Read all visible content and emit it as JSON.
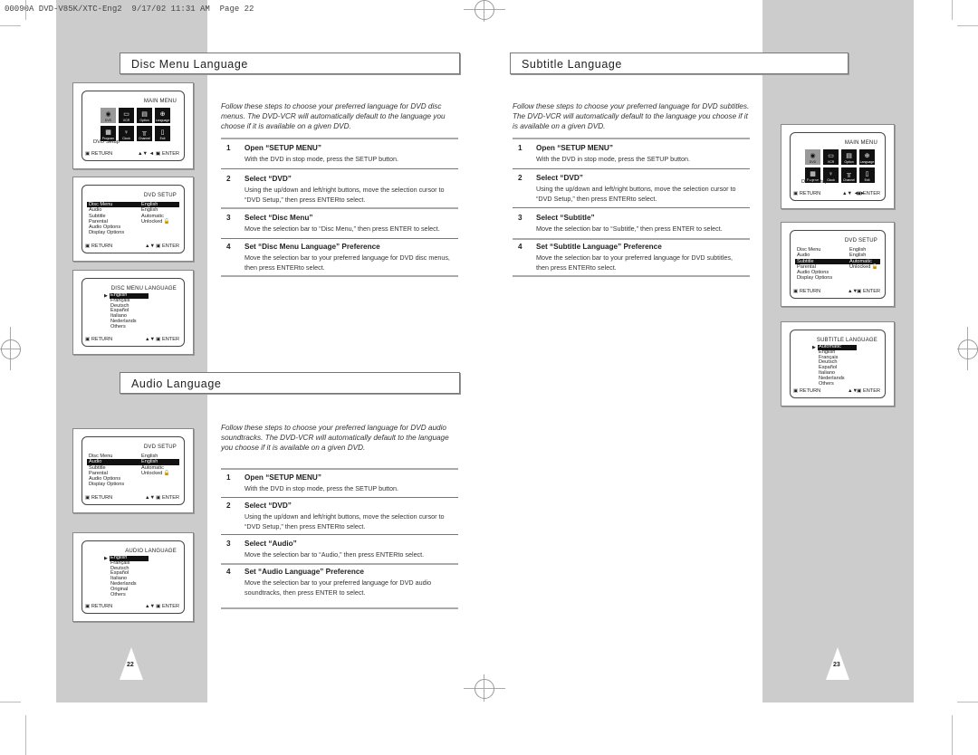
{
  "header": {
    "slug": "00090A DVD-V85K/XTC-Eng2  9/17/02 11:31 AM  Page 22"
  },
  "left_page": {
    "page_number": "22",
    "disc_menu": {
      "title": "Disc Menu Language",
      "intro": "Follow these steps to choose your preferred language for DVD disc menus. The DVD-VCR will automatically default to the language you choose if it is available on a given DVD.",
      "steps": [
        {
          "num": "1",
          "title": "Open “SETUP MENU”",
          "body": "With the DVD in stop mode, press the SETUP button."
        },
        {
          "num": "2",
          "title": "Select “DVD”",
          "body": "Using the up/down and left/right buttons, move the selection cursor to “DVD Setup,” then press ENTERto select."
        },
        {
          "num": "3",
          "title": "Select “Disc Menu”",
          "body": "Move the selection bar to “Disc Menu,” then press ENTER to select."
        },
        {
          "num": "4",
          "title": "Set “Disc Menu Language” Preference",
          "body": "Move the selection bar to your preferred language for DVD disc menus, then press ENTERto select."
        }
      ],
      "screens": {
        "main_menu": {
          "title": "MAIN MENU",
          "caption": "DVD Setup"
        },
        "dvd_setup": {
          "title": "DVD SETUP",
          "selected": "Disc Menu"
        },
        "language": {
          "title": "DISC MENU LANGUAGE",
          "items": [
            "English",
            "Français",
            "Deutsch",
            "Español",
            "Italiano",
            "Nederlands",
            "Others"
          ],
          "selected": "English"
        }
      }
    },
    "audio": {
      "title": "Audio Language",
      "intro": "Follow these steps to choose your preferred language for DVD audio soundtracks. The DVD-VCR will automatically default to the language you choose if it is available on a given DVD.",
      "steps": [
        {
          "num": "1",
          "title": "Open “SETUP MENU”",
          "body": "With the DVD in stop mode, press the SETUP button."
        },
        {
          "num": "2",
          "title": "Select “DVD”",
          "body": "Using the up/down and left/right buttons, move the selection cursor to “DVD Setup,” then press ENTERto select."
        },
        {
          "num": "3",
          "title": "Select “Audio”",
          "body": "Move the selection bar to “Audio,” then press ENTERto select."
        },
        {
          "num": "4",
          "title": "Set “Audio Language” Preference",
          "body": "Move the selection bar to your preferred language for DVD audio soundtracks, then press ENTER to select."
        }
      ],
      "screens": {
        "dvd_setup": {
          "title": "DVD SETUP",
          "selected": "Audio"
        },
        "language": {
          "title": "AUDIO LANGUAGE",
          "items": [
            "English",
            "Français",
            "Deutsch",
            "Español",
            "Italiano",
            "Nederlands",
            "Original",
            "Others"
          ],
          "selected": "English"
        }
      }
    }
  },
  "right_page": {
    "page_number": "23",
    "subtitle": {
      "title": "Subtitle Language",
      "intro": "Follow these steps to choose your preferred language for DVD subtitles. The DVD-VCR will automatically default to the language you choose if it is available on a given DVD.",
      "steps": [
        {
          "num": "1",
          "title": "Open “SETUP MENU”",
          "body": "With the DVD in stop mode, press the SETUP button."
        },
        {
          "num": "2",
          "title": "Select “DVD”",
          "body": "Using the up/down and left/right buttons, move the selection cursor to “DVD Setup,” then press ENTERto select."
        },
        {
          "num": "3",
          "title": "Select “Subtitle”",
          "body": "Move the selection bar to “Subtitle,” then press ENTER to select."
        },
        {
          "num": "4",
          "title": "Set “Subtitle Language” Preference",
          "body": "Move the selection bar to your preferred language for DVD subtitles, then press ENTERto select."
        }
      ],
      "screens": {
        "main_menu": {
          "title": "MAIN MENU",
          "caption": "DVD Setup"
        },
        "dvd_setup": {
          "title": "DVD SETUP",
          "selected": "Subtitle"
        },
        "language": {
          "title": "SUBTITLE LANGUAGE",
          "items": [
            "Automatic",
            "English",
            "Français",
            "Deutsch",
            "Español",
            "Italiano",
            "Nederlands",
            "Others"
          ],
          "selected": "Automatic"
        }
      }
    }
  },
  "osd_common": {
    "return_label": "RETURN",
    "enter_label": "ENTER",
    "nav_4way": "▲▼ ◄ ►",
    "nav_2way": "▲▼",
    "main_menu_icons": [
      "DVD",
      "VCR",
      "Option",
      "Language",
      "Program",
      "Clock",
      "Channel",
      "Exit"
    ],
    "setup_rows": [
      {
        "key": "Disc Menu",
        "value": "English"
      },
      {
        "key": "Audio",
        "value": "English"
      },
      {
        "key": "Subtitle",
        "value": "Automatic"
      },
      {
        "key": "Parental",
        "value": "Unlocked"
      },
      {
        "key": "Audio Options",
        "value": ""
      },
      {
        "key": "Display Options",
        "value": ""
      }
    ]
  }
}
